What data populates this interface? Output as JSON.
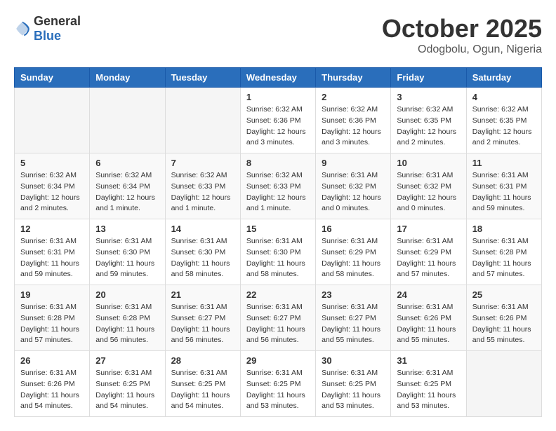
{
  "header": {
    "logo": {
      "general": "General",
      "blue": "Blue"
    },
    "month": "October 2025",
    "location": "Odogbolu, Ogun, Nigeria"
  },
  "weekdays": [
    "Sunday",
    "Monday",
    "Tuesday",
    "Wednesday",
    "Thursday",
    "Friday",
    "Saturday"
  ],
  "weeks": [
    [
      {
        "day": "",
        "info": ""
      },
      {
        "day": "",
        "info": ""
      },
      {
        "day": "",
        "info": ""
      },
      {
        "day": "1",
        "info": "Sunrise: 6:32 AM\nSunset: 6:36 PM\nDaylight: 12 hours\nand 3 minutes."
      },
      {
        "day": "2",
        "info": "Sunrise: 6:32 AM\nSunset: 6:36 PM\nDaylight: 12 hours\nand 3 minutes."
      },
      {
        "day": "3",
        "info": "Sunrise: 6:32 AM\nSunset: 6:35 PM\nDaylight: 12 hours\nand 2 minutes."
      },
      {
        "day": "4",
        "info": "Sunrise: 6:32 AM\nSunset: 6:35 PM\nDaylight: 12 hours\nand 2 minutes."
      }
    ],
    [
      {
        "day": "5",
        "info": "Sunrise: 6:32 AM\nSunset: 6:34 PM\nDaylight: 12 hours\nand 2 minutes."
      },
      {
        "day": "6",
        "info": "Sunrise: 6:32 AM\nSunset: 6:34 PM\nDaylight: 12 hours\nand 1 minute."
      },
      {
        "day": "7",
        "info": "Sunrise: 6:32 AM\nSunset: 6:33 PM\nDaylight: 12 hours\nand 1 minute."
      },
      {
        "day": "8",
        "info": "Sunrise: 6:32 AM\nSunset: 6:33 PM\nDaylight: 12 hours\nand 1 minute."
      },
      {
        "day": "9",
        "info": "Sunrise: 6:31 AM\nSunset: 6:32 PM\nDaylight: 12 hours\nand 0 minutes."
      },
      {
        "day": "10",
        "info": "Sunrise: 6:31 AM\nSunset: 6:32 PM\nDaylight: 12 hours\nand 0 minutes."
      },
      {
        "day": "11",
        "info": "Sunrise: 6:31 AM\nSunset: 6:31 PM\nDaylight: 11 hours\nand 59 minutes."
      }
    ],
    [
      {
        "day": "12",
        "info": "Sunrise: 6:31 AM\nSunset: 6:31 PM\nDaylight: 11 hours\nand 59 minutes."
      },
      {
        "day": "13",
        "info": "Sunrise: 6:31 AM\nSunset: 6:30 PM\nDaylight: 11 hours\nand 59 minutes."
      },
      {
        "day": "14",
        "info": "Sunrise: 6:31 AM\nSunset: 6:30 PM\nDaylight: 11 hours\nand 58 minutes."
      },
      {
        "day": "15",
        "info": "Sunrise: 6:31 AM\nSunset: 6:30 PM\nDaylight: 11 hours\nand 58 minutes."
      },
      {
        "day": "16",
        "info": "Sunrise: 6:31 AM\nSunset: 6:29 PM\nDaylight: 11 hours\nand 58 minutes."
      },
      {
        "day": "17",
        "info": "Sunrise: 6:31 AM\nSunset: 6:29 PM\nDaylight: 11 hours\nand 57 minutes."
      },
      {
        "day": "18",
        "info": "Sunrise: 6:31 AM\nSunset: 6:28 PM\nDaylight: 11 hours\nand 57 minutes."
      }
    ],
    [
      {
        "day": "19",
        "info": "Sunrise: 6:31 AM\nSunset: 6:28 PM\nDaylight: 11 hours\nand 57 minutes."
      },
      {
        "day": "20",
        "info": "Sunrise: 6:31 AM\nSunset: 6:28 PM\nDaylight: 11 hours\nand 56 minutes."
      },
      {
        "day": "21",
        "info": "Sunrise: 6:31 AM\nSunset: 6:27 PM\nDaylight: 11 hours\nand 56 minutes."
      },
      {
        "day": "22",
        "info": "Sunrise: 6:31 AM\nSunset: 6:27 PM\nDaylight: 11 hours\nand 56 minutes."
      },
      {
        "day": "23",
        "info": "Sunrise: 6:31 AM\nSunset: 6:27 PM\nDaylight: 11 hours\nand 55 minutes."
      },
      {
        "day": "24",
        "info": "Sunrise: 6:31 AM\nSunset: 6:26 PM\nDaylight: 11 hours\nand 55 minutes."
      },
      {
        "day": "25",
        "info": "Sunrise: 6:31 AM\nSunset: 6:26 PM\nDaylight: 11 hours\nand 55 minutes."
      }
    ],
    [
      {
        "day": "26",
        "info": "Sunrise: 6:31 AM\nSunset: 6:26 PM\nDaylight: 11 hours\nand 54 minutes."
      },
      {
        "day": "27",
        "info": "Sunrise: 6:31 AM\nSunset: 6:25 PM\nDaylight: 11 hours\nand 54 minutes."
      },
      {
        "day": "28",
        "info": "Sunrise: 6:31 AM\nSunset: 6:25 PM\nDaylight: 11 hours\nand 54 minutes."
      },
      {
        "day": "29",
        "info": "Sunrise: 6:31 AM\nSunset: 6:25 PM\nDaylight: 11 hours\nand 53 minutes."
      },
      {
        "day": "30",
        "info": "Sunrise: 6:31 AM\nSunset: 6:25 PM\nDaylight: 11 hours\nand 53 minutes."
      },
      {
        "day": "31",
        "info": "Sunrise: 6:31 AM\nSunset: 6:25 PM\nDaylight: 11 hours\nand 53 minutes."
      },
      {
        "day": "",
        "info": ""
      }
    ]
  ]
}
